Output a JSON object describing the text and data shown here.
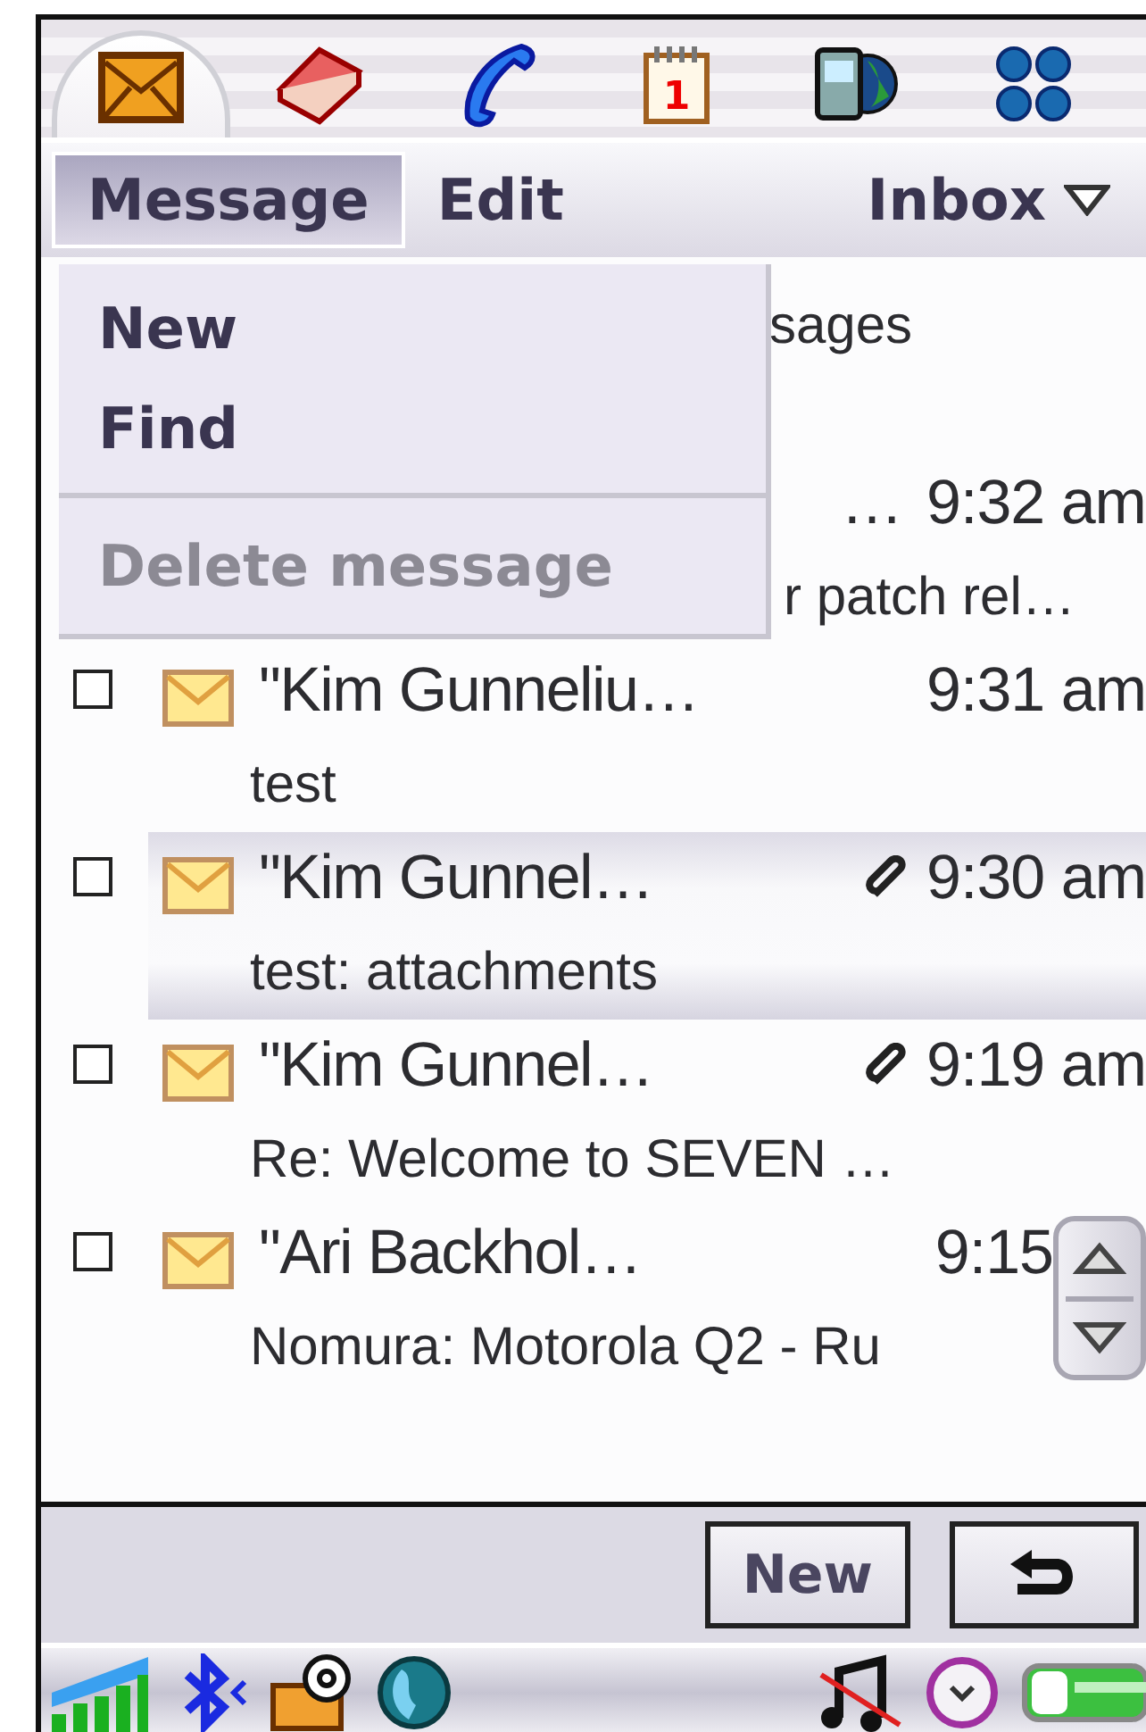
{
  "app_bar": {
    "apps": [
      {
        "kind": "mail",
        "selected": true
      },
      {
        "kind": "contacts",
        "selected": false
      },
      {
        "kind": "phone",
        "selected": false
      },
      {
        "kind": "calendar",
        "selected": false,
        "day": "1"
      },
      {
        "kind": "web",
        "selected": false
      },
      {
        "kind": "launcher",
        "selected": false
      }
    ]
  },
  "menu_bar": {
    "menus": [
      {
        "label": "Message",
        "selected": true
      },
      {
        "label": "Edit",
        "selected": false
      }
    ],
    "folder": "Inbox"
  },
  "dropdown": {
    "items": [
      {
        "kind": "item",
        "label": "New",
        "disabled": false
      },
      {
        "kind": "item",
        "label": "Find",
        "disabled": false
      },
      {
        "kind": "separator"
      },
      {
        "kind": "item",
        "label": "Delete message",
        "disabled": true
      }
    ]
  },
  "message_list": {
    "header": "sages",
    "messages": [
      {
        "kind": "partial",
        "sender": "…",
        "time": "9:32 am",
        "subject": "r patch rel…"
      },
      {
        "kind": "full",
        "checked": false,
        "selected": false,
        "attachment": false,
        "sender": "\"Kim Gunneliu…",
        "time": "9:31 am",
        "subject": "test"
      },
      {
        "kind": "full",
        "checked": false,
        "selected": true,
        "attachment": true,
        "sender": "\"Kim Gunnel…",
        "time": "9:30 am",
        "subject": "test: attachments"
      },
      {
        "kind": "full",
        "checked": false,
        "selected": false,
        "attachment": true,
        "sender": "\"Kim Gunnel…",
        "time": "9:19 am",
        "subject": "Re: Welcome to SEVEN …"
      },
      {
        "kind": "full",
        "checked": false,
        "selected": false,
        "attachment": false,
        "sender": "\"Ari Backhol…",
        "time": "9:15",
        "subject": "Nomura: Motorola Q2 - Ru"
      }
    ]
  },
  "softkeys": [
    {
      "kind": "text",
      "label": "New"
    },
    {
      "kind": "back"
    }
  ]
}
